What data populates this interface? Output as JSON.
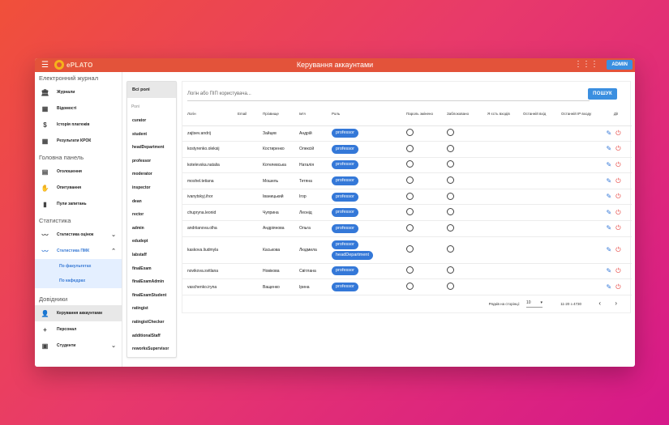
{
  "topbar": {
    "logo": "ePLATO",
    "title": "Керування аккаунтами",
    "admin": "ADMIN"
  },
  "sidebar": {
    "sec1": "Електронний журнал",
    "journals": "Журнали",
    "sheets": "Відомості",
    "payments": "Історія платежів",
    "krok": "Результати КРОК",
    "sec2": "Головна панель",
    "notices": "Оголошення",
    "polls": "Опитування",
    "questions": "Пули запитань",
    "sec3": "Статистика",
    "stat_grades": "Статистика оцінок",
    "stat_pmk": "Статистика ПМК",
    "by_faculty": "По факультетах",
    "by_department": "По кафедрах",
    "sec4": "Довідники",
    "accounts": "Керування аккаунтами",
    "staff": "Персонал",
    "students": "Студенти"
  },
  "roles": {
    "all": "Всі ролі",
    "label": "Ролі",
    "items": [
      "curator",
      "student",
      "headDepartment",
      "professor",
      "moderator",
      "inspector",
      "dean",
      "rector",
      "admin",
      "edudept",
      "labstaff",
      "finalExam",
      "finalExamAdmin",
      "finalExamStudent",
      "ratingist",
      "ratingistChecker",
      "additionalStaff",
      "reworksSupervisor"
    ]
  },
  "search": {
    "placeholder": "Логін або ПІП користувача...",
    "button": "ПОШУК"
  },
  "table": {
    "headers": [
      "Логін",
      "Email",
      "Прізвище",
      "Ім'я",
      "Роль",
      "Пароль змінено",
      "Заблоковано",
      "Я єсть входів",
      "Останній вхід",
      "Останній IP входу",
      "Дії"
    ],
    "rows": [
      {
        "login": "zajtsev.andrij",
        "last": "Зайцев",
        "first": "Андрій",
        "roles": [
          "professor"
        ]
      },
      {
        "login": "kostyrenko.oleksij",
        "last": "Костиренко",
        "first": "Олексій",
        "roles": [
          "professor"
        ]
      },
      {
        "login": "kotelevska.natalia",
        "last": "Котелевська",
        "first": "Наталія",
        "roles": [
          "professor"
        ]
      },
      {
        "login": "moshel.tetiana",
        "last": "Мошель",
        "first": "Тетяна",
        "roles": [
          "professor"
        ]
      },
      {
        "login": "ivanytskyj.ihor",
        "last": "Іваницький",
        "first": "Ігор",
        "roles": [
          "professor"
        ]
      },
      {
        "login": "chupryna.leonid",
        "last": "Чуприна",
        "first": "Леонід",
        "roles": [
          "professor"
        ]
      },
      {
        "login": "andriianova.olha",
        "last": "Андріянова",
        "first": "Ольга",
        "roles": [
          "professor"
        ]
      },
      {
        "login": "kaskova.liudmyla",
        "last": "Каськова",
        "first": "Людмила",
        "roles": [
          "professor",
          "headDepartment"
        ]
      },
      {
        "login": "novikova.svitlana",
        "last": "Новікова",
        "first": "Світлана",
        "roles": [
          "professor"
        ]
      },
      {
        "login": "vaschenko.iryna",
        "last": "Ващенко",
        "first": "Ірина",
        "roles": [
          "professor"
        ]
      }
    ]
  },
  "pager": {
    "rows_label": "Рядків на сторінці:",
    "per_page": "10",
    "range": "11-20 з 4730"
  },
  "colors": {
    "accent": "#3478d8",
    "topbar": "#e3533a",
    "danger": "#e53935"
  }
}
